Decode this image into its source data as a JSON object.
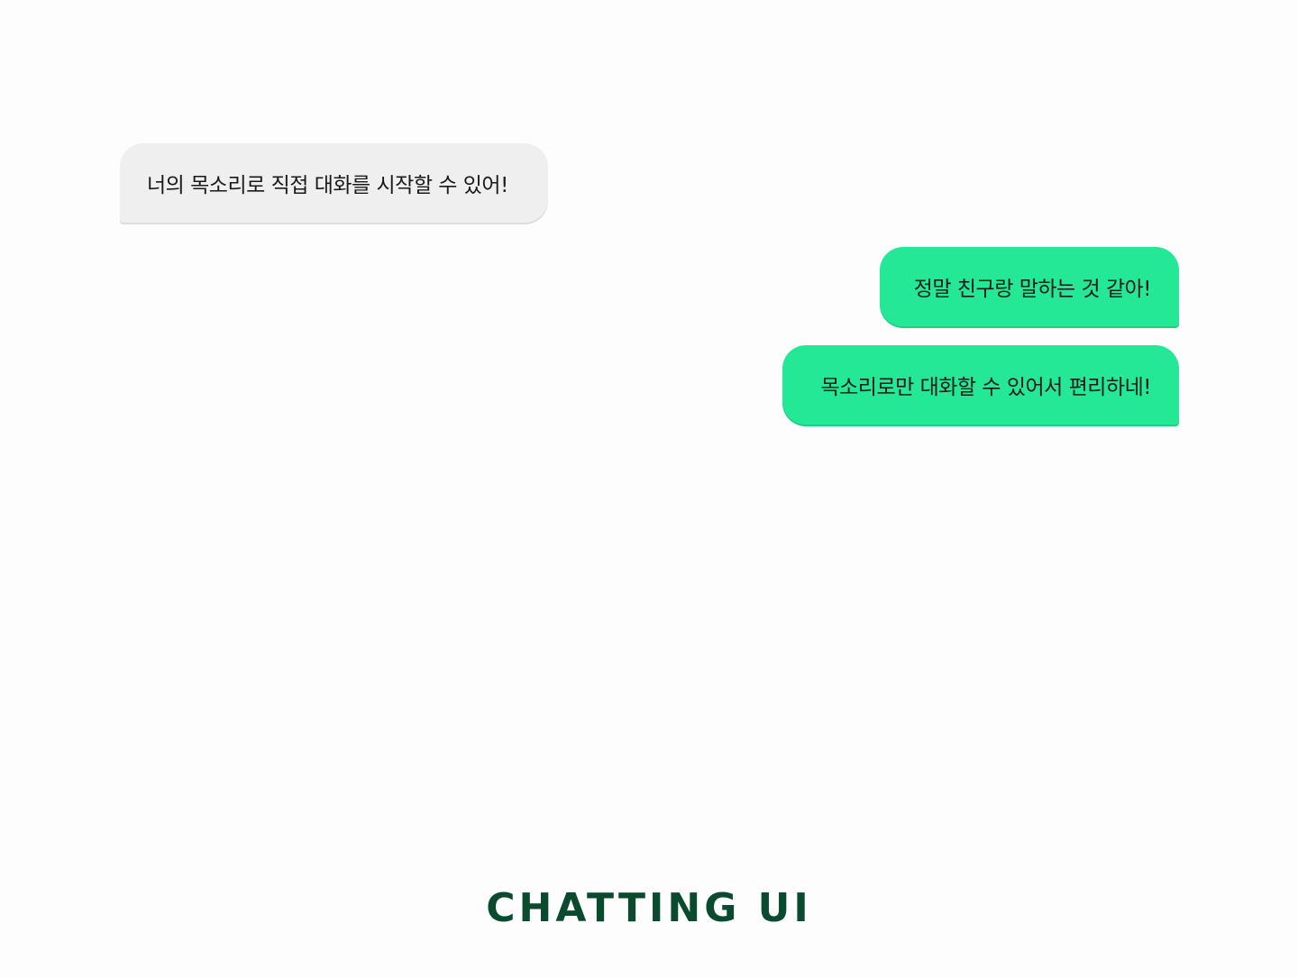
{
  "messages": [
    {
      "direction": "received",
      "text": "너의 목소리로 직접 대화를 시작할 수 있어!"
    },
    {
      "direction": "sent",
      "text": "정말 친구랑 말하는 것 같아!"
    },
    {
      "direction": "sent",
      "text": "목소리로만 대화할 수 있어서 편리하네!"
    }
  ],
  "title": "CHATTING UI",
  "colors": {
    "background": "#fdfdfd",
    "received_bubble": "#efefef",
    "sent_bubble": "#25e896",
    "message_text": "#1a1a1a",
    "title_text": "#0a4a2e"
  }
}
